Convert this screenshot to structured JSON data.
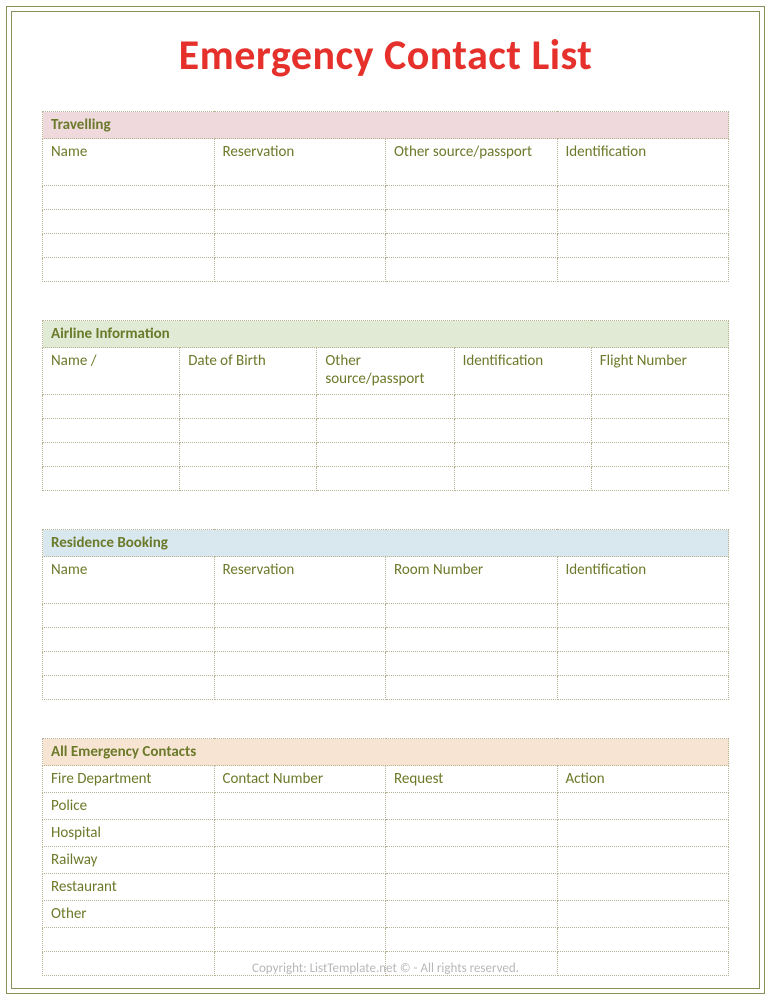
{
  "title": "Emergency Contact List",
  "sections": {
    "travelling": {
      "title": "Travelling",
      "headers": [
        "Name",
        "Reservation",
        "Other source/passport",
        "Identification"
      ],
      "rows": [
        [
          "",
          "",
          "",
          ""
        ],
        [
          "",
          "",
          "",
          ""
        ],
        [
          "",
          "",
          "",
          ""
        ],
        [
          "",
          "",
          "",
          ""
        ]
      ]
    },
    "airline": {
      "title": "Airline Information",
      "headers": [
        "Name /",
        "Date of Birth",
        "Other source/passport",
        "Identification",
        "Flight Number"
      ],
      "rows": [
        [
          "",
          "",
          "",
          "",
          ""
        ],
        [
          "",
          "",
          "",
          "",
          ""
        ],
        [
          "",
          "",
          "",
          "",
          ""
        ],
        [
          "",
          "",
          "",
          "",
          ""
        ]
      ]
    },
    "residence": {
      "title": "Residence Booking",
      "headers": [
        "Name",
        "Reservation",
        "Room Number",
        "Identification"
      ],
      "rows": [
        [
          "",
          "",
          "",
          ""
        ],
        [
          "",
          "",
          "",
          ""
        ],
        [
          "",
          "",
          "",
          ""
        ],
        [
          "",
          "",
          "",
          ""
        ]
      ]
    },
    "emergency": {
      "title": "All Emergency Contacts",
      "headers": [
        "Fire Department",
        "Contact Number",
        "Request",
        "Action"
      ],
      "rows": [
        [
          "Police",
          "",
          "",
          ""
        ],
        [
          "Hospital",
          "",
          "",
          ""
        ],
        [
          "Railway",
          "",
          "",
          ""
        ],
        [
          "Restaurant",
          "",
          "",
          ""
        ],
        [
          "Other",
          "",
          "",
          ""
        ],
        [
          "",
          "",
          "",
          ""
        ],
        [
          "",
          "",
          "",
          ""
        ]
      ]
    }
  },
  "footer": "Copyright: ListTemplate.net © - All rights reserved."
}
